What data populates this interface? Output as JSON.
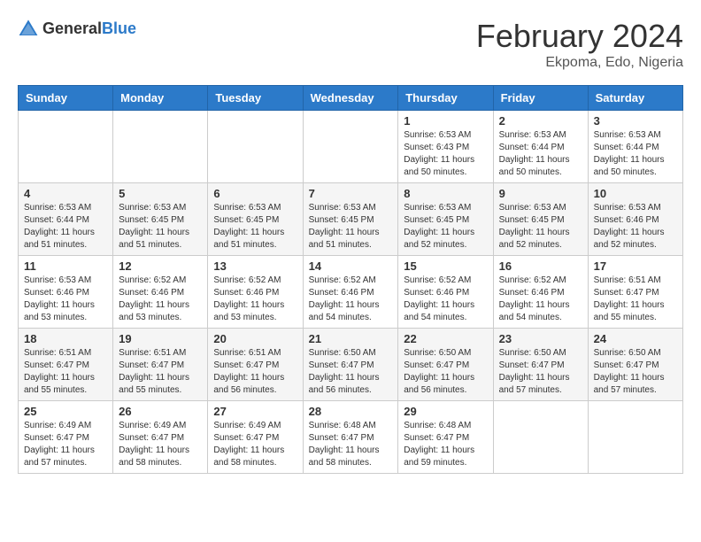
{
  "header": {
    "logo_general": "General",
    "logo_blue": "Blue",
    "month_year": "February 2024",
    "location": "Ekpoma, Edo, Nigeria"
  },
  "columns": [
    "Sunday",
    "Monday",
    "Tuesday",
    "Wednesday",
    "Thursday",
    "Friday",
    "Saturday"
  ],
  "weeks": [
    [
      {
        "day": "",
        "info": ""
      },
      {
        "day": "",
        "info": ""
      },
      {
        "day": "",
        "info": ""
      },
      {
        "day": "",
        "info": ""
      },
      {
        "day": "1",
        "info": "Sunrise: 6:53 AM\nSunset: 6:43 PM\nDaylight: 11 hours\nand 50 minutes."
      },
      {
        "day": "2",
        "info": "Sunrise: 6:53 AM\nSunset: 6:44 PM\nDaylight: 11 hours\nand 50 minutes."
      },
      {
        "day": "3",
        "info": "Sunrise: 6:53 AM\nSunset: 6:44 PM\nDaylight: 11 hours\nand 50 minutes."
      }
    ],
    [
      {
        "day": "4",
        "info": "Sunrise: 6:53 AM\nSunset: 6:44 PM\nDaylight: 11 hours\nand 51 minutes."
      },
      {
        "day": "5",
        "info": "Sunrise: 6:53 AM\nSunset: 6:45 PM\nDaylight: 11 hours\nand 51 minutes."
      },
      {
        "day": "6",
        "info": "Sunrise: 6:53 AM\nSunset: 6:45 PM\nDaylight: 11 hours\nand 51 minutes."
      },
      {
        "day": "7",
        "info": "Sunrise: 6:53 AM\nSunset: 6:45 PM\nDaylight: 11 hours\nand 51 minutes."
      },
      {
        "day": "8",
        "info": "Sunrise: 6:53 AM\nSunset: 6:45 PM\nDaylight: 11 hours\nand 52 minutes."
      },
      {
        "day": "9",
        "info": "Sunrise: 6:53 AM\nSunset: 6:45 PM\nDaylight: 11 hours\nand 52 minutes."
      },
      {
        "day": "10",
        "info": "Sunrise: 6:53 AM\nSunset: 6:46 PM\nDaylight: 11 hours\nand 52 minutes."
      }
    ],
    [
      {
        "day": "11",
        "info": "Sunrise: 6:53 AM\nSunset: 6:46 PM\nDaylight: 11 hours\nand 53 minutes."
      },
      {
        "day": "12",
        "info": "Sunrise: 6:52 AM\nSunset: 6:46 PM\nDaylight: 11 hours\nand 53 minutes."
      },
      {
        "day": "13",
        "info": "Sunrise: 6:52 AM\nSunset: 6:46 PM\nDaylight: 11 hours\nand 53 minutes."
      },
      {
        "day": "14",
        "info": "Sunrise: 6:52 AM\nSunset: 6:46 PM\nDaylight: 11 hours\nand 54 minutes."
      },
      {
        "day": "15",
        "info": "Sunrise: 6:52 AM\nSunset: 6:46 PM\nDaylight: 11 hours\nand 54 minutes."
      },
      {
        "day": "16",
        "info": "Sunrise: 6:52 AM\nSunset: 6:46 PM\nDaylight: 11 hours\nand 54 minutes."
      },
      {
        "day": "17",
        "info": "Sunrise: 6:51 AM\nSunset: 6:47 PM\nDaylight: 11 hours\nand 55 minutes."
      }
    ],
    [
      {
        "day": "18",
        "info": "Sunrise: 6:51 AM\nSunset: 6:47 PM\nDaylight: 11 hours\nand 55 minutes."
      },
      {
        "day": "19",
        "info": "Sunrise: 6:51 AM\nSunset: 6:47 PM\nDaylight: 11 hours\nand 55 minutes."
      },
      {
        "day": "20",
        "info": "Sunrise: 6:51 AM\nSunset: 6:47 PM\nDaylight: 11 hours\nand 56 minutes."
      },
      {
        "day": "21",
        "info": "Sunrise: 6:50 AM\nSunset: 6:47 PM\nDaylight: 11 hours\nand 56 minutes."
      },
      {
        "day": "22",
        "info": "Sunrise: 6:50 AM\nSunset: 6:47 PM\nDaylight: 11 hours\nand 56 minutes."
      },
      {
        "day": "23",
        "info": "Sunrise: 6:50 AM\nSunset: 6:47 PM\nDaylight: 11 hours\nand 57 minutes."
      },
      {
        "day": "24",
        "info": "Sunrise: 6:50 AM\nSunset: 6:47 PM\nDaylight: 11 hours\nand 57 minutes."
      }
    ],
    [
      {
        "day": "25",
        "info": "Sunrise: 6:49 AM\nSunset: 6:47 PM\nDaylight: 11 hours\nand 57 minutes."
      },
      {
        "day": "26",
        "info": "Sunrise: 6:49 AM\nSunset: 6:47 PM\nDaylight: 11 hours\nand 58 minutes."
      },
      {
        "day": "27",
        "info": "Sunrise: 6:49 AM\nSunset: 6:47 PM\nDaylight: 11 hours\nand 58 minutes."
      },
      {
        "day": "28",
        "info": "Sunrise: 6:48 AM\nSunset: 6:47 PM\nDaylight: 11 hours\nand 58 minutes."
      },
      {
        "day": "29",
        "info": "Sunrise: 6:48 AM\nSunset: 6:47 PM\nDaylight: 11 hours\nand 59 minutes."
      },
      {
        "day": "",
        "info": ""
      },
      {
        "day": "",
        "info": ""
      }
    ]
  ]
}
